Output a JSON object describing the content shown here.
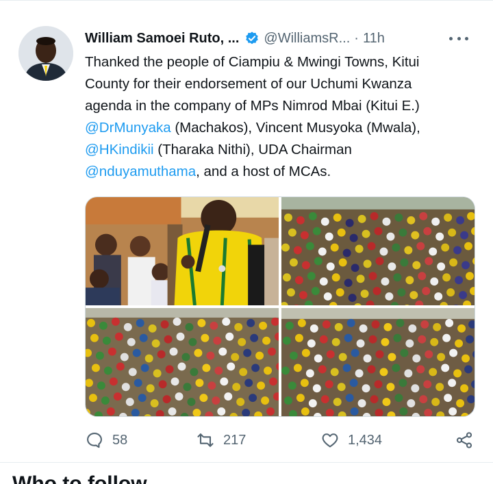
{
  "tweet": {
    "author_name": "William Samoei Ruto, ...",
    "handle": "@WilliamsR...",
    "separator": "·",
    "time": "11h",
    "text_lines": [
      [
        {
          "text": "Thanked the people of Ciampiu & Mwingi Towns, Kitui",
          "mention": false
        }
      ],
      [
        {
          "text": "County for their endorsement of our Uchumi Kwanza",
          "mention": false
        }
      ],
      [
        {
          "text": "agenda in the company of MPs Nimrod Mbai (Kitui E.)",
          "mention": false
        }
      ],
      [
        {
          "text": "@DrMunyaka",
          "mention": true
        },
        {
          "text": " (Machakos), Vincent Musyoka (Mwala),",
          "mention": false
        }
      ],
      [
        {
          "text": "@HKindikii",
          "mention": true
        },
        {
          "text": " (Tharaka Nithi), UDA Chairman",
          "mention": false
        }
      ],
      [
        {
          "text": "@nduyamuthama",
          "mention": true
        },
        {
          "text": ", and a host of MCAs.",
          "mention": false
        }
      ]
    ]
  },
  "media": [
    {
      "icon": "photo-speaker-crowd"
    },
    {
      "icon": "photo-crowd"
    },
    {
      "icon": "photo-crowd"
    },
    {
      "icon": "photo-crowd"
    }
  ],
  "actions": {
    "replies": "58",
    "retweets": "217",
    "likes": "1,434"
  },
  "next_section": {
    "heading": "Who to follow"
  },
  "colors": {
    "accent": "#1d9bf0",
    "text": "#0f1419",
    "muted": "#536471",
    "border": "#cfd9de"
  }
}
